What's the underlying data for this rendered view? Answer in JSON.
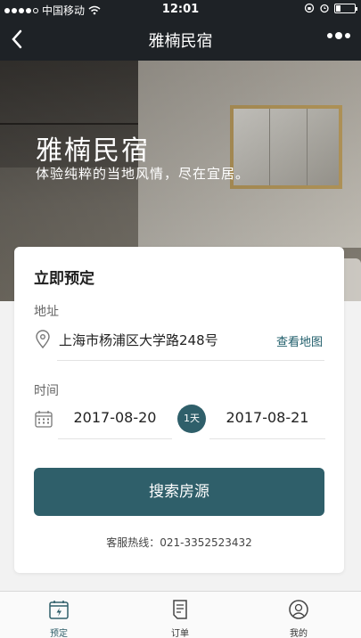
{
  "status_bar": {
    "carrier": "中国移动",
    "time": "12:01"
  },
  "nav": {
    "title": "雅楠民宿"
  },
  "hero": {
    "title": "雅楠民宿",
    "subtitle": "体验纯粹的当地风情，尽在宜居。"
  },
  "booking": {
    "title": "立即预定",
    "address_label": "地址",
    "address": "上海市杨浦区大学路248号",
    "map_link": "查看地图",
    "time_label": "时间",
    "start_date": "2017-08-20",
    "end_date": "2017-08-21",
    "nights": "1天",
    "search_button": "搜索房源",
    "hotline": "客服热线：021-3352523432"
  },
  "tabs": [
    {
      "label": "预定",
      "icon": "calendar-bolt-icon"
    },
    {
      "label": "订单",
      "icon": "document-icon"
    },
    {
      "label": "我的",
      "icon": "person-icon"
    }
  ],
  "colors": {
    "accent": "#2f5f6a",
    "nav_bg": "#1e2226"
  }
}
